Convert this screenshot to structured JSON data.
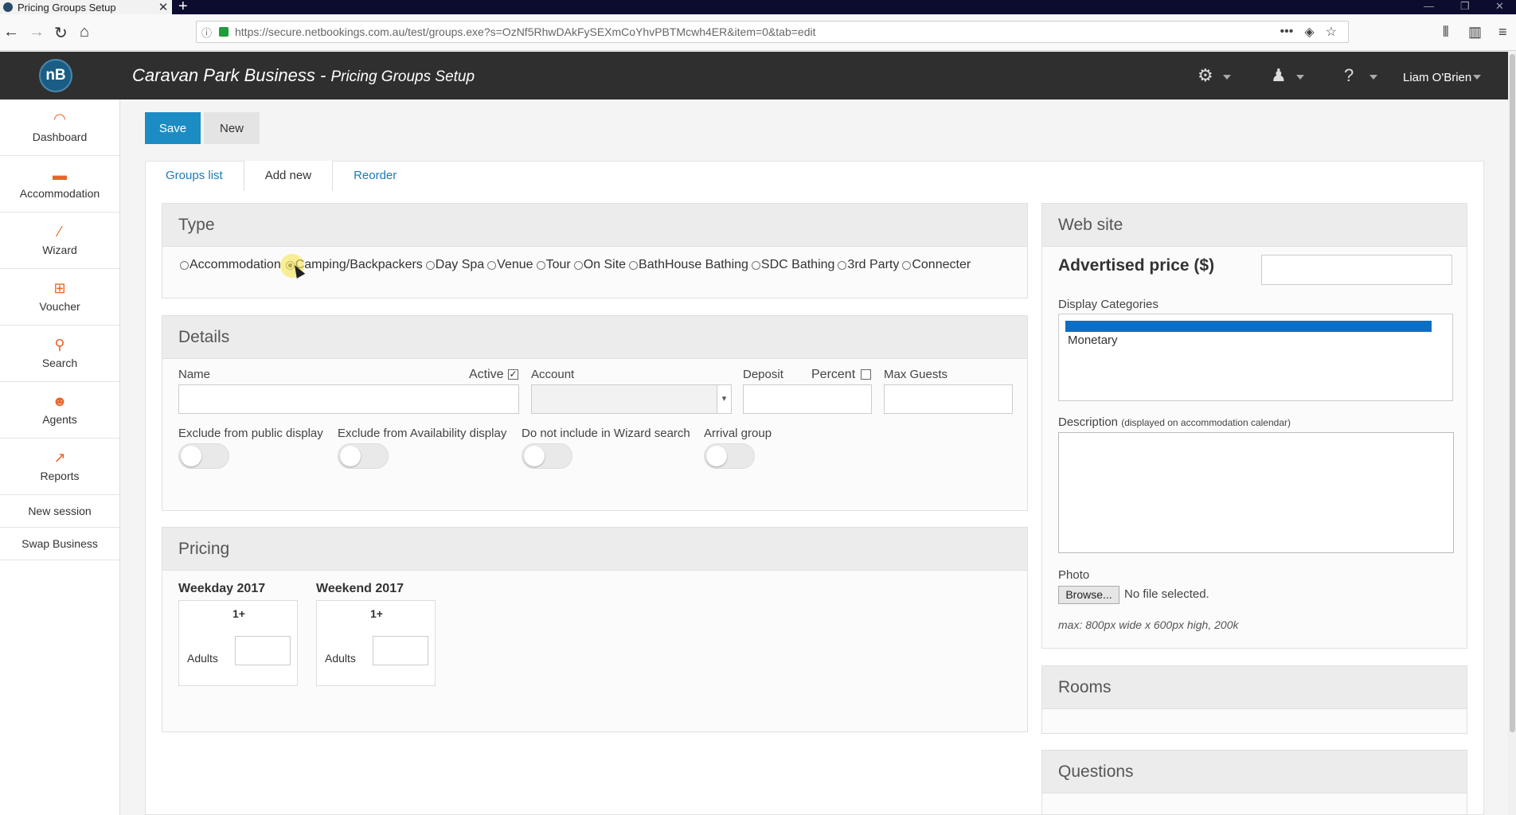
{
  "browser": {
    "tab_title": "Pricing Groups Setup",
    "url": "https://secure.netbookings.com.au/test/groups.exe?s=OzNf5RhwDAkFySEXmCoYhvPBTMcwh4ER&item=0&tab=edit"
  },
  "header": {
    "logo": "nB",
    "title": "Caravan Park Business",
    "separator": " - ",
    "subtitle": "Pricing Groups Setup",
    "user": "Liam O'Brien"
  },
  "sidebar": {
    "items": [
      {
        "label": "Dashboard",
        "icon": "dashboard-icon"
      },
      {
        "label": "Accommodation",
        "icon": "bed-icon"
      },
      {
        "label": "Wizard",
        "icon": "wand-icon"
      },
      {
        "label": "Voucher",
        "icon": "gift-icon"
      },
      {
        "label": "Search",
        "icon": "search-icon"
      },
      {
        "label": "Agents",
        "icon": "agent-icon"
      },
      {
        "label": "Reports",
        "icon": "chart-icon"
      }
    ],
    "new_session": "New session",
    "swap_business": "Swap Business"
  },
  "actions": {
    "save": "Save",
    "new": "New"
  },
  "tabs": [
    "Groups list",
    "Add new",
    "Reorder"
  ],
  "type": {
    "title": "Type",
    "options": [
      "Accommodation",
      "Camping/Backpackers",
      "Day Spa",
      "Venue",
      "Tour",
      "On Site",
      "BathHouse Bathing",
      "SDC Bathing",
      "3rd Party",
      "Connecter"
    ],
    "selected": "Camping/Backpackers"
  },
  "details": {
    "title": "Details",
    "name_label": "Name",
    "active_label": "Active",
    "active_checked": true,
    "account_label": "Account",
    "deposit_label": "Deposit",
    "percent_label": "Percent",
    "max_guests_label": "Max Guests",
    "toggles": [
      "Exclude from public display",
      "Exclude from Availability display",
      "Do not include in Wizard search",
      "Arrival group"
    ]
  },
  "pricing": {
    "title": "Pricing",
    "periods": [
      {
        "name": "Weekday 2017",
        "column": "1+",
        "row": "Adults"
      },
      {
        "name": "Weekend 2017",
        "column": "1+",
        "row": "Adults"
      }
    ]
  },
  "website": {
    "title": "Web site",
    "advertised_price": "Advertised price ($)",
    "display_categories": "Display Categories",
    "categories": [
      "Monetary"
    ],
    "description_label": "Description",
    "description_note": "(displayed on accommodation calendar)",
    "photo_label": "Photo",
    "browse": "Browse...",
    "no_file": "No file selected.",
    "photo_hint": "max: 800px wide x 600px high, 200k"
  },
  "rooms": {
    "title": "Rooms"
  },
  "questions": {
    "title": "Questions"
  },
  "colors": {
    "accent": "#1c8cc4",
    "header": "#2f2f2f",
    "icon": "#e8652a"
  }
}
